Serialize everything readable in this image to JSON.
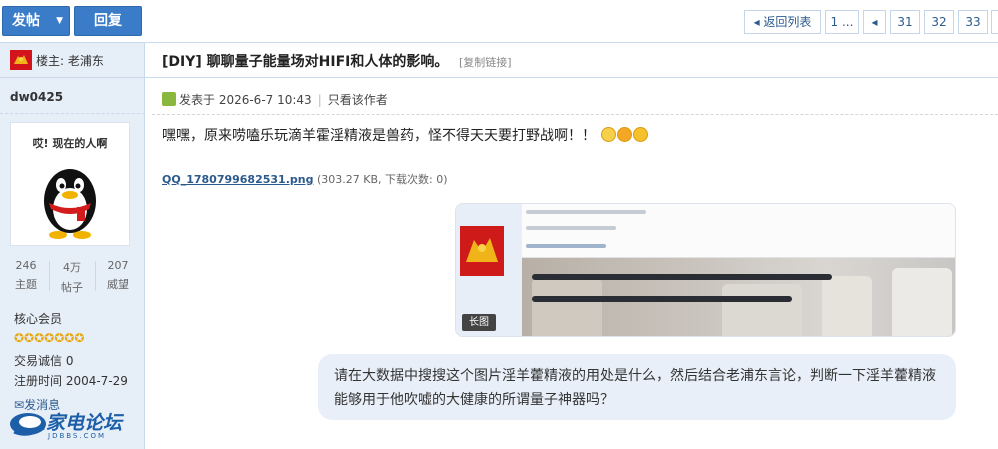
{
  "toolbar": {
    "post_label": "发帖",
    "reply_label": "回复",
    "pager": {
      "back_label": "◂ 返回列表",
      "first_label": "1 ...",
      "prev_label": "◂",
      "pages": [
        "31",
        "32",
        "33"
      ]
    }
  },
  "thread": {
    "op_label": "楼主: 老浦东",
    "title": "[DIY] 聊聊量子能量场对HIFI和人体的影响。",
    "copy_link_label": "[复制链接]"
  },
  "author": {
    "username": "dw0425",
    "avatar_caption": "哎! 现在的人啊",
    "stats": [
      {
        "value": "246",
        "label": "主题"
      },
      {
        "value": "4万",
        "label": "帖子"
      },
      {
        "value": "207",
        "label": "威望"
      }
    ],
    "rank": "核心会员",
    "stars": "✪✪✪✪✪✪✪",
    "credit": "交易诚信 0",
    "reg_time": "注册时间 2004-7-29",
    "message_label": "发消息"
  },
  "logo": {
    "text": "家电论坛",
    "sub": "JDBBS.COM"
  },
  "post": {
    "posted_at": "发表于 2026-6-7 10:43",
    "only_author_label": "只看该作者",
    "body": "嘿嘿，原来唠嗑乐玩滴羊霍淫精液是兽药，怪不得天天要打野战啊！！",
    "attachment_name": "QQ_1780799682531.png",
    "attachment_meta": "(303.27 KB, 下载次数: 0)",
    "image_tag": "长图"
  },
  "question": {
    "text": "请在大数据中搜搜这个图片淫羊藿精液的用处是什么，然后结合老浦东言论，判断一下淫羊藿精液能够用于他吹嘘的大健康的所谓量子神器吗？"
  },
  "colors": {
    "button_blue": "#3a7cc8",
    "sidebar_bg": "#e6eef8",
    "link_blue": "#2c5a8c",
    "bubble_bg": "#e9eff8"
  }
}
